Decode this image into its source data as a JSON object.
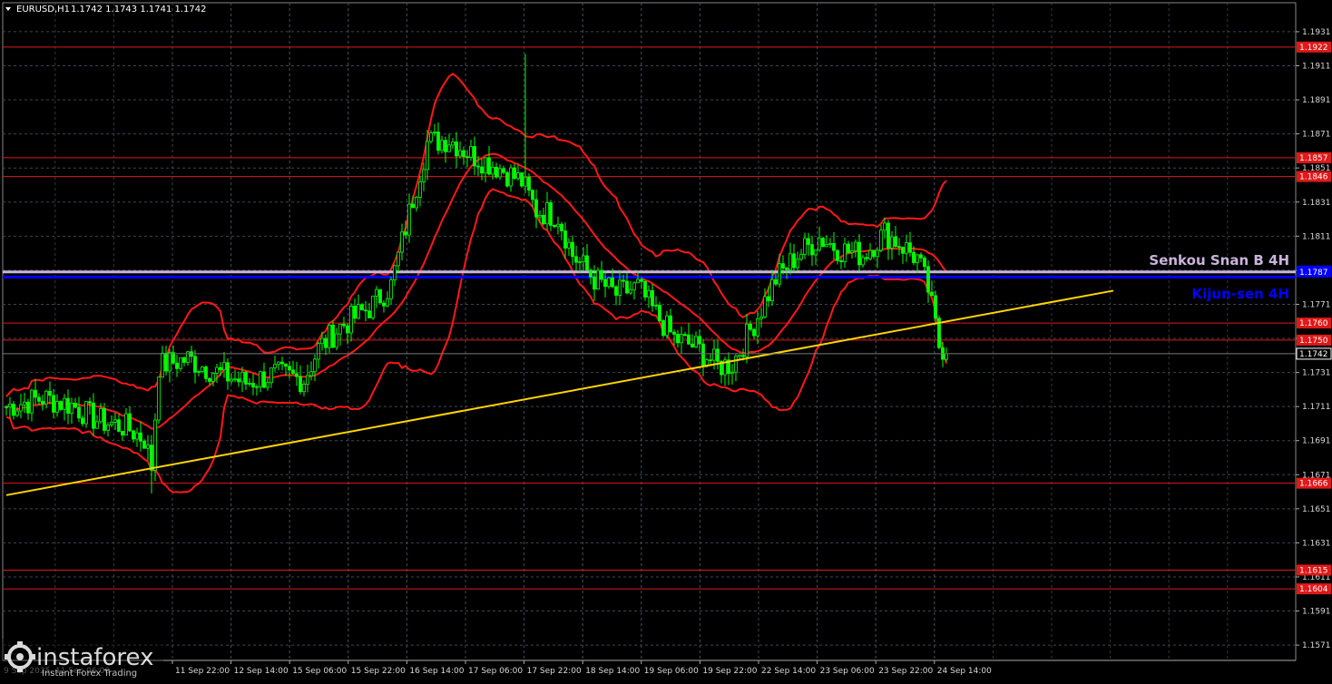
{
  "header": {
    "symbol": "EURUSD,H1",
    "ohlc": "1.1742 1.1743 1.1741 1.1742"
  },
  "colors": {
    "background": "#000000",
    "grid": "#3c4650",
    "level": "#e01818",
    "level_tag": "#e01818",
    "trend": "#ffd400",
    "bollinger": "#ff1818",
    "candle": "#00ff00",
    "kijun": "#0000ff",
    "senkou": "#c8b4dc",
    "price_tag": "#000000"
  },
  "watermark": {
    "brand": "instaforex",
    "tagline": "Instant Forex Trading",
    "logo_icon": "gear-icon"
  },
  "labels": {
    "senkou": "Senkou Snan B 4H",
    "kijun": "Kijun-sen 4H"
  },
  "chart_data": {
    "type": "candlestick",
    "title": "EURUSD,H1",
    "ylim": [
      1.1562,
      1.1948
    ],
    "y_ticks": [
      1.1931,
      1.1911,
      1.1891,
      1.1871,
      1.1851,
      1.1831,
      1.1811,
      1.1791,
      1.1771,
      1.1751,
      1.1731,
      1.1711,
      1.1691,
      1.1671,
      1.1651,
      1.1631,
      1.1611,
      1.1591,
      1.1571
    ],
    "x_ticks": [
      "11 Sep 22:00",
      "12 Sep 14:00",
      "15 Sep 06:00",
      "15 Sep 22:00",
      "16 Sep 14:00",
      "17 Sep 06:00",
      "17 Sep 22:00",
      "18 Sep 14:00",
      "19 Sep 06:00",
      "19 Sep 22:00",
      "22 Sep 14:00",
      "23 Sep 06:00",
      "23 Sep 22:00",
      "24 Sep 14:00"
    ],
    "x_tick_partial": "9 Sep 2025, 11 Sep 06:00",
    "last_price": "1.1742",
    "horizontal_levels": [
      {
        "value": 1.1922,
        "label": "1.1922"
      },
      {
        "value": 1.1857,
        "label": "1.1857"
      },
      {
        "value": 1.1846,
        "label": "1.1846"
      },
      {
        "value": 1.176,
        "label": "1.1760"
      },
      {
        "value": 1.175,
        "label": "1.1750"
      },
      {
        "value": 1.1666,
        "label": "1.1666"
      },
      {
        "value": 1.1615,
        "label": "1.1615"
      },
      {
        "value": 1.1604,
        "label": "1.1604"
      }
    ],
    "senkou_b": {
      "value": 1.179,
      "label": "1.1790"
    },
    "kijun": {
      "value": 1.1787,
      "label": "1.1787"
    },
    "trend_line": {
      "start": {
        "bar": 0,
        "price": 1.1659
      },
      "end": {
        "bar": 305,
        "price": 1.1779
      }
    },
    "bars_shown": 260,
    "close_path": [
      [
        0,
        1.1711
      ],
      [
        10,
        1.1716
      ],
      [
        18,
        1.1712
      ],
      [
        25,
        1.1703
      ],
      [
        33,
        1.1699
      ],
      [
        38,
        1.1692
      ],
      [
        40,
        1.1676
      ],
      [
        42,
        1.1735
      ],
      [
        50,
        1.1739
      ],
      [
        58,
        1.1731
      ],
      [
        66,
        1.1725
      ],
      [
        74,
        1.173
      ],
      [
        82,
        1.1727
      ],
      [
        86,
        1.1745
      ],
      [
        92,
        1.1758
      ],
      [
        100,
        1.1769
      ],
      [
        106,
        1.1782
      ],
      [
        112,
        1.1833
      ],
      [
        116,
        1.1866
      ],
      [
        122,
        1.1868
      ],
      [
        128,
        1.1859
      ],
      [
        136,
        1.1851
      ],
      [
        142,
        1.1843
      ],
      [
        146,
        1.1826
      ],
      [
        152,
        1.1823
      ],
      [
        156,
        1.18
      ],
      [
        162,
        1.1786
      ],
      [
        168,
        1.1777
      ],
      [
        174,
        1.1781
      ],
      [
        178,
        1.1768
      ],
      [
        184,
        1.1751
      ],
      [
        190,
        1.1746
      ],
      [
        196,
        1.1735
      ],
      [
        200,
        1.1736
      ],
      [
        206,
        1.176
      ],
      [
        212,
        1.1786
      ],
      [
        218,
        1.18
      ],
      [
        224,
        1.181
      ],
      [
        230,
        1.1803
      ],
      [
        236,
        1.18
      ],
      [
        242,
        1.1813
      ],
      [
        246,
        1.1807
      ],
      [
        251,
        1.1798
      ],
      [
        254,
        1.178
      ],
      [
        257,
        1.1747
      ],
      [
        260,
        1.1742
      ]
    ]
  }
}
